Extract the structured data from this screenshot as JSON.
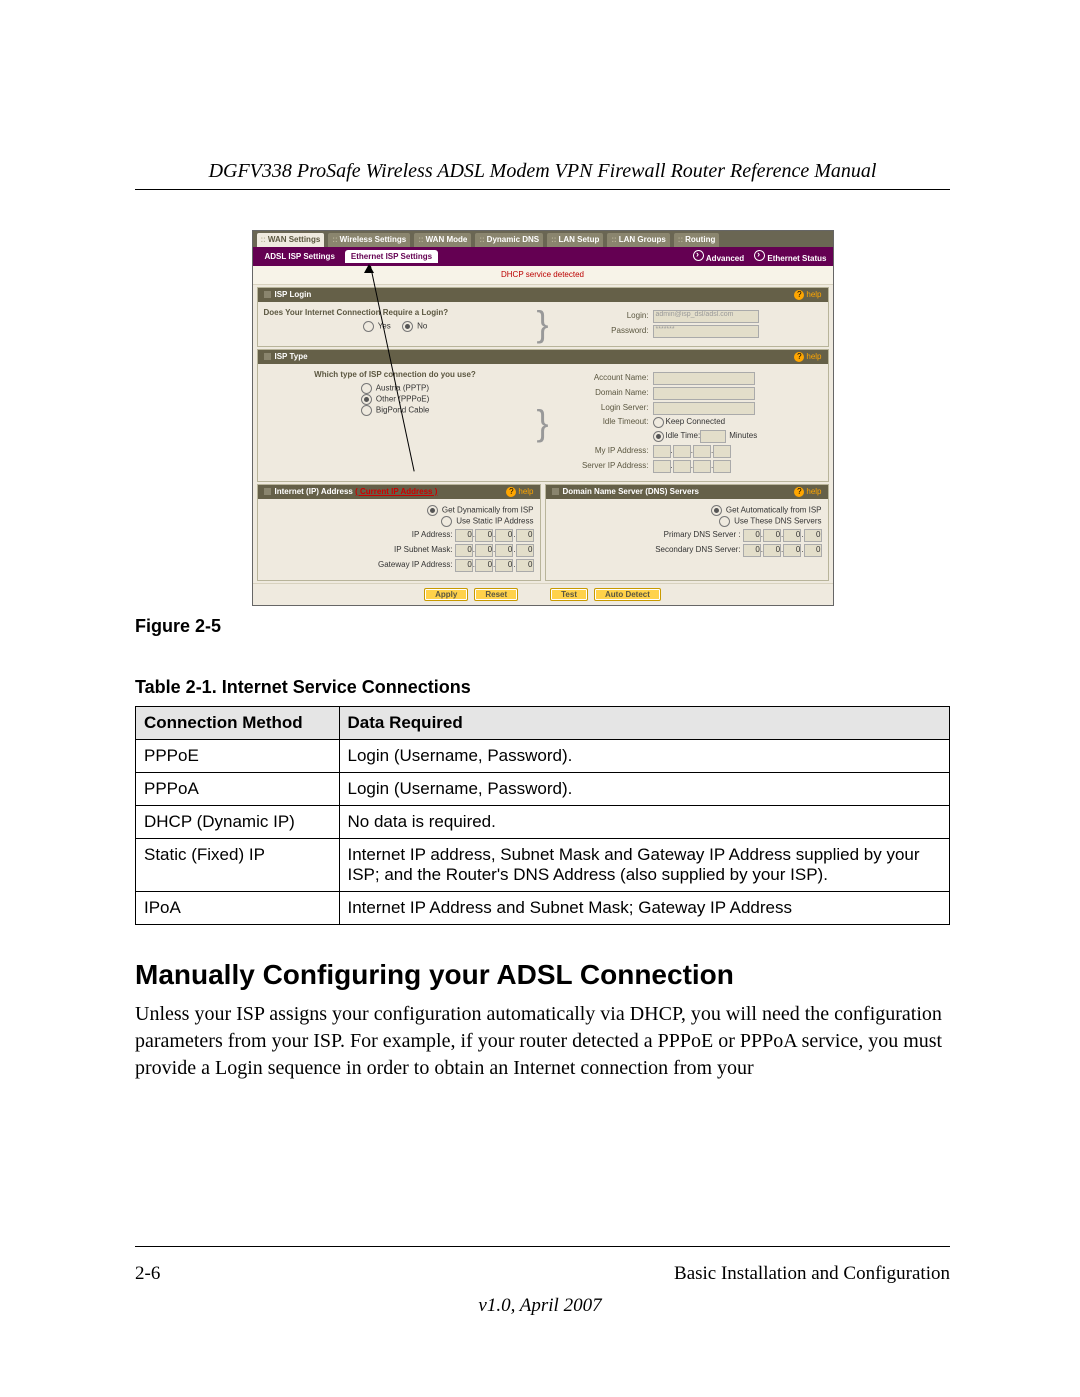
{
  "doc": {
    "title": "DGFV338 ProSafe Wireless ADSL Modem VPN Firewall Router Reference Manual",
    "figure_caption": "Figure 2-5",
    "table_caption": "Table 2-1.  Internet Service Connections",
    "section_heading": "Manually Configuring your ADSL Connection",
    "body_p1": "Unless your ISP assigns your configuration automatically via DHCP, you will need the configuration parameters from your ISP. For example, if your router detected a PPPoE or PPPoA service, you must provide a Login sequence in order to obtain an Internet connection from your",
    "page_number": "2-6",
    "chapter": "Basic Installation and Configuration",
    "version": "v1.0, April 2007"
  },
  "conn_table": {
    "headers": [
      "Connection Method",
      "Data Required"
    ],
    "rows": [
      [
        "PPPoE",
        "Login (Username, Password)."
      ],
      [
        "PPPoA",
        "Login (Username, Password)."
      ],
      [
        "DHCP (Dynamic IP)",
        "No data is required."
      ],
      [
        "Static (Fixed) IP",
        "Internet IP address, Subnet Mask and Gateway IP Address supplied by your ISP; and the Router's DNS Address (also supplied by your ISP)."
      ],
      [
        "IPoA",
        "Internet IP Address and Subnet Mask; Gateway IP Address"
      ]
    ]
  },
  "router": {
    "main_tabs": [
      "WAN Settings",
      "Wireless Settings",
      "WAN Mode",
      "Dynamic DNS",
      "LAN Setup",
      "LAN Groups",
      "Routing"
    ],
    "sub_tabs": {
      "a": "ADSL ISP Settings",
      "b": "Ethernet ISP Settings"
    },
    "subbar_right": {
      "advanced": "Advanced",
      "status": "Ethernet Status"
    },
    "detect_msg": "DHCP service detected",
    "help_label": "help",
    "isp_login": {
      "panel_title": "ISP Login",
      "question": "Does Your Internet Connection Require a Login?",
      "yes": "Yes",
      "no": "No",
      "login_label": "Login:",
      "password_label": "Password:",
      "login_value": "admin@isp_dsl/adsl.com",
      "password_value": "*******"
    },
    "isp_type": {
      "panel_title": "ISP Type",
      "question": "Which type of ISP connection do you use?",
      "opt1": "Austria (PPTP)",
      "opt2": "Other (PPPoE)",
      "opt3": "BigPond Cable",
      "account_label": "Account Name:",
      "domain_label": "Domain Name:",
      "loginsrv_label": "Login Server:",
      "idle_to_label": "Idle Timeout:",
      "keep_label": "Keep Connected",
      "idle_time_label": "Idle Time:",
      "minutes": "Minutes",
      "myip_label": "My IP Address:",
      "srvip_label": "Server IP Address:"
    },
    "ip_panel": {
      "title_a": "Internet (IP) Address",
      "title_b": "( Current IP Address )",
      "opt_dyn": "Get Dynamically from ISP",
      "opt_static": "Use Static IP Address",
      "ip_label": "IP Address:",
      "mask_label": "IP Subnet Mask:",
      "gw_label": "Gateway IP Address:"
    },
    "dns_panel": {
      "title": "Domain Name Server (DNS) Servers",
      "opt_auto": "Get Automatically from ISP",
      "opt_these": "Use These DNS Servers",
      "primary_label": "Primary DNS Server :",
      "secondary_label": "Secondary DNS Server:"
    },
    "buttons": {
      "apply": "Apply",
      "reset": "Reset",
      "test": "Test",
      "auto": "Auto Detect"
    }
  }
}
